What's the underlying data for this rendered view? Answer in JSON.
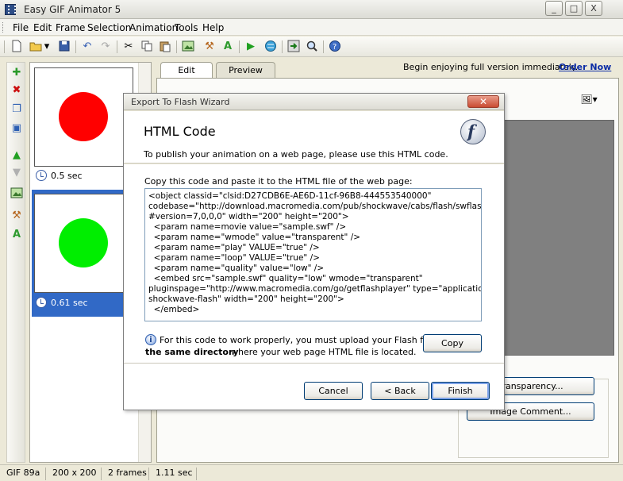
{
  "app": {
    "title": "Easy GIF Animator 5",
    "window_buttons": {
      "minimize": "_",
      "maximize": "□",
      "close": "X"
    }
  },
  "menu": [
    "File",
    "Edit",
    "Frame",
    "Selection",
    "Animation",
    "Tools",
    "Help"
  ],
  "toolbar_icons": [
    "new-icon",
    "open-icon",
    "open-dropdown-icon",
    "save-icon",
    "undo-icon",
    "redo-icon",
    "cut-icon",
    "copy-icon",
    "paste-icon",
    "image-edit-icon",
    "magic-wand-icon",
    "text-icon",
    "play-icon",
    "web-preview-icon",
    "export-icon",
    "zoom-icon",
    "help-icon"
  ],
  "frames": [
    {
      "delay": "0.5 sec",
      "circle_color": "#ff0000",
      "selected": false
    },
    {
      "delay": "0.61 sec",
      "circle_color": "#00ee00",
      "selected": true
    }
  ],
  "tabs": {
    "edit": "Edit",
    "preview": "Preview"
  },
  "promo": {
    "text": "Begin enjoying full version immediately.",
    "link": "Order Now"
  },
  "right_buttons": {
    "transparency": "Transparency...",
    "image_comment": "Image Comment..."
  },
  "status": {
    "format": "GIF 89a",
    "size": "200 x 200",
    "frames": "2 frames",
    "duration": "1.11 sec"
  },
  "dialog": {
    "title": "Export To Flash Wizard",
    "heading": "HTML Code",
    "subtitle": "To publish your animation on a web page, please use this HTML code.",
    "copy_label": "Copy this code and paste it to the HTML file of the web page:",
    "code": "<object classid=\"clsid:D27CDB6E-AE6D-11cf-96B8-444553540000\"\ncodebase=\"http://download.macromedia.com/pub/shockwave/cabs/flash/swflash.cab\n#version=7,0,0,0\" width=\"200\" height=\"200\">\n  <param name=movie value=\"sample.swf\" />\n  <param name=\"wmode\" value=\"transparent\" />\n  <param name=\"play\" VALUE=\"true\" />\n  <param name=\"loop\" VALUE=\"true\" />\n  <param name=\"quality\" value=\"low\" />\n  <embed src=\"sample.swf\" quality=\"low\" wmode=\"transparent\"\npluginspage=\"http://www.macromedia.com/go/getflashplayer\" type=\"application/x-\nshockwave-flash\" width=\"200\" height=\"200\">\n  </embed>",
    "info_line1": "For this code to work properly, you must upload your Flash file to",
    "info_bold": "the same directory",
    "info_line2": "where your web page HTML file is located.",
    "buttons": {
      "copy": "Copy",
      "cancel": "Cancel",
      "back": "< Back",
      "finish": "Finish"
    }
  }
}
